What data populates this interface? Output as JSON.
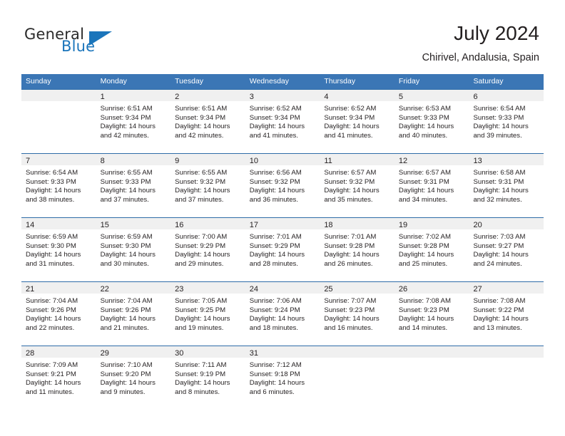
{
  "logo": {
    "word1": "General",
    "word2": "Blue",
    "triangle_icon": "triangle-icon",
    "brand_color": "#1b75bb"
  },
  "header": {
    "title": "July 2024",
    "location": "Chirivel, Andalusia, Spain"
  },
  "theme": {
    "header_blue": "#3b76b5",
    "row_divider": "#2e6ca8",
    "daynum_band": "#f0f0f0",
    "text": "#231f20"
  },
  "weekdays": [
    "Sunday",
    "Monday",
    "Tuesday",
    "Wednesday",
    "Thursday",
    "Friday",
    "Saturday"
  ],
  "weeks": [
    [
      {
        "day": "",
        "sunrise": "",
        "sunset": "",
        "daylight1": "",
        "daylight2": ""
      },
      {
        "day": "1",
        "sunrise": "Sunrise: 6:51 AM",
        "sunset": "Sunset: 9:34 PM",
        "daylight1": "Daylight: 14 hours",
        "daylight2": "and 42 minutes."
      },
      {
        "day": "2",
        "sunrise": "Sunrise: 6:51 AM",
        "sunset": "Sunset: 9:34 PM",
        "daylight1": "Daylight: 14 hours",
        "daylight2": "and 42 minutes."
      },
      {
        "day": "3",
        "sunrise": "Sunrise: 6:52 AM",
        "sunset": "Sunset: 9:34 PM",
        "daylight1": "Daylight: 14 hours",
        "daylight2": "and 41 minutes."
      },
      {
        "day": "4",
        "sunrise": "Sunrise: 6:52 AM",
        "sunset": "Sunset: 9:34 PM",
        "daylight1": "Daylight: 14 hours",
        "daylight2": "and 41 minutes."
      },
      {
        "day": "5",
        "sunrise": "Sunrise: 6:53 AM",
        "sunset": "Sunset: 9:33 PM",
        "daylight1": "Daylight: 14 hours",
        "daylight2": "and 40 minutes."
      },
      {
        "day": "6",
        "sunrise": "Sunrise: 6:54 AM",
        "sunset": "Sunset: 9:33 PM",
        "daylight1": "Daylight: 14 hours",
        "daylight2": "and 39 minutes."
      }
    ],
    [
      {
        "day": "7",
        "sunrise": "Sunrise: 6:54 AM",
        "sunset": "Sunset: 9:33 PM",
        "daylight1": "Daylight: 14 hours",
        "daylight2": "and 38 minutes."
      },
      {
        "day": "8",
        "sunrise": "Sunrise: 6:55 AM",
        "sunset": "Sunset: 9:33 PM",
        "daylight1": "Daylight: 14 hours",
        "daylight2": "and 37 minutes."
      },
      {
        "day": "9",
        "sunrise": "Sunrise: 6:55 AM",
        "sunset": "Sunset: 9:32 PM",
        "daylight1": "Daylight: 14 hours",
        "daylight2": "and 37 minutes."
      },
      {
        "day": "10",
        "sunrise": "Sunrise: 6:56 AM",
        "sunset": "Sunset: 9:32 PM",
        "daylight1": "Daylight: 14 hours",
        "daylight2": "and 36 minutes."
      },
      {
        "day": "11",
        "sunrise": "Sunrise: 6:57 AM",
        "sunset": "Sunset: 9:32 PM",
        "daylight1": "Daylight: 14 hours",
        "daylight2": "and 35 minutes."
      },
      {
        "day": "12",
        "sunrise": "Sunrise: 6:57 AM",
        "sunset": "Sunset: 9:31 PM",
        "daylight1": "Daylight: 14 hours",
        "daylight2": "and 34 minutes."
      },
      {
        "day": "13",
        "sunrise": "Sunrise: 6:58 AM",
        "sunset": "Sunset: 9:31 PM",
        "daylight1": "Daylight: 14 hours",
        "daylight2": "and 32 minutes."
      }
    ],
    [
      {
        "day": "14",
        "sunrise": "Sunrise: 6:59 AM",
        "sunset": "Sunset: 9:30 PM",
        "daylight1": "Daylight: 14 hours",
        "daylight2": "and 31 minutes."
      },
      {
        "day": "15",
        "sunrise": "Sunrise: 6:59 AM",
        "sunset": "Sunset: 9:30 PM",
        "daylight1": "Daylight: 14 hours",
        "daylight2": "and 30 minutes."
      },
      {
        "day": "16",
        "sunrise": "Sunrise: 7:00 AM",
        "sunset": "Sunset: 9:29 PM",
        "daylight1": "Daylight: 14 hours",
        "daylight2": "and 29 minutes."
      },
      {
        "day": "17",
        "sunrise": "Sunrise: 7:01 AM",
        "sunset": "Sunset: 9:29 PM",
        "daylight1": "Daylight: 14 hours",
        "daylight2": "and 28 minutes."
      },
      {
        "day": "18",
        "sunrise": "Sunrise: 7:01 AM",
        "sunset": "Sunset: 9:28 PM",
        "daylight1": "Daylight: 14 hours",
        "daylight2": "and 26 minutes."
      },
      {
        "day": "19",
        "sunrise": "Sunrise: 7:02 AM",
        "sunset": "Sunset: 9:28 PM",
        "daylight1": "Daylight: 14 hours",
        "daylight2": "and 25 minutes."
      },
      {
        "day": "20",
        "sunrise": "Sunrise: 7:03 AM",
        "sunset": "Sunset: 9:27 PM",
        "daylight1": "Daylight: 14 hours",
        "daylight2": "and 24 minutes."
      }
    ],
    [
      {
        "day": "21",
        "sunrise": "Sunrise: 7:04 AM",
        "sunset": "Sunset: 9:26 PM",
        "daylight1": "Daylight: 14 hours",
        "daylight2": "and 22 minutes."
      },
      {
        "day": "22",
        "sunrise": "Sunrise: 7:04 AM",
        "sunset": "Sunset: 9:26 PM",
        "daylight1": "Daylight: 14 hours",
        "daylight2": "and 21 minutes."
      },
      {
        "day": "23",
        "sunrise": "Sunrise: 7:05 AM",
        "sunset": "Sunset: 9:25 PM",
        "daylight1": "Daylight: 14 hours",
        "daylight2": "and 19 minutes."
      },
      {
        "day": "24",
        "sunrise": "Sunrise: 7:06 AM",
        "sunset": "Sunset: 9:24 PM",
        "daylight1": "Daylight: 14 hours",
        "daylight2": "and 18 minutes."
      },
      {
        "day": "25",
        "sunrise": "Sunrise: 7:07 AM",
        "sunset": "Sunset: 9:23 PM",
        "daylight1": "Daylight: 14 hours",
        "daylight2": "and 16 minutes."
      },
      {
        "day": "26",
        "sunrise": "Sunrise: 7:08 AM",
        "sunset": "Sunset: 9:23 PM",
        "daylight1": "Daylight: 14 hours",
        "daylight2": "and 14 minutes."
      },
      {
        "day": "27",
        "sunrise": "Sunrise: 7:08 AM",
        "sunset": "Sunset: 9:22 PM",
        "daylight1": "Daylight: 14 hours",
        "daylight2": "and 13 minutes."
      }
    ],
    [
      {
        "day": "28",
        "sunrise": "Sunrise: 7:09 AM",
        "sunset": "Sunset: 9:21 PM",
        "daylight1": "Daylight: 14 hours",
        "daylight2": "and 11 minutes."
      },
      {
        "day": "29",
        "sunrise": "Sunrise: 7:10 AM",
        "sunset": "Sunset: 9:20 PM",
        "daylight1": "Daylight: 14 hours",
        "daylight2": "and 9 minutes."
      },
      {
        "day": "30",
        "sunrise": "Sunrise: 7:11 AM",
        "sunset": "Sunset: 9:19 PM",
        "daylight1": "Daylight: 14 hours",
        "daylight2": "and 8 minutes."
      },
      {
        "day": "31",
        "sunrise": "Sunrise: 7:12 AM",
        "sunset": "Sunset: 9:18 PM",
        "daylight1": "Daylight: 14 hours",
        "daylight2": "and 6 minutes."
      },
      {
        "day": "",
        "sunrise": "",
        "sunset": "",
        "daylight1": "",
        "daylight2": ""
      },
      {
        "day": "",
        "sunrise": "",
        "sunset": "",
        "daylight1": "",
        "daylight2": ""
      },
      {
        "day": "",
        "sunrise": "",
        "sunset": "",
        "daylight1": "",
        "daylight2": ""
      }
    ]
  ]
}
